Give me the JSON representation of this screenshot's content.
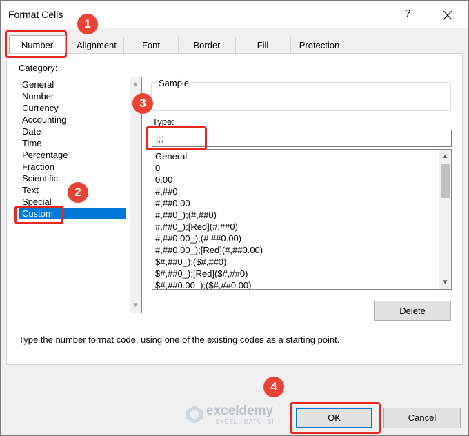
{
  "window": {
    "title": "Format Cells",
    "help": "?",
    "close_icon": "close-icon"
  },
  "tabs": [
    {
      "label": "Number",
      "active": true
    },
    {
      "label": "Alignment",
      "active": false
    },
    {
      "label": "Font",
      "active": false
    },
    {
      "label": "Border",
      "active": false
    },
    {
      "label": "Fill",
      "active": false
    },
    {
      "label": "Protection",
      "active": false
    }
  ],
  "category": {
    "label": "Category:",
    "items": [
      "General",
      "Number",
      "Currency",
      "Accounting",
      "Date",
      "Time",
      "Percentage",
      "Fraction",
      "Scientific",
      "Text",
      "Special",
      "Custom"
    ],
    "selected": "Custom"
  },
  "sample": {
    "label": "Sample",
    "value": ""
  },
  "type": {
    "label": "Type:",
    "value": ";;;"
  },
  "format_codes": [
    "General",
    "0",
    "0.00",
    "#,##0",
    "#,##0.00",
    "#,##0_);(#,##0)",
    "#,##0_);[Red](#,##0)",
    "#,##0.00_);(#,##0.00)",
    "#,##0.00_);[Red](#,##0.00)",
    "$#,##0_);($#,##0)",
    "$#,##0_);[Red]($#,##0)",
    "$#,##0.00_);($#,##0.00)"
  ],
  "buttons": {
    "delete": "Delete",
    "ok": "OK",
    "cancel": "Cancel"
  },
  "hint": "Type the number format code, using one of the existing codes as a starting point.",
  "watermark": {
    "name": "exceldemy",
    "tagline": "EXCEL · DATA · BI"
  },
  "annotations": [
    {
      "step": "1"
    },
    {
      "step": "2"
    },
    {
      "step": "3"
    },
    {
      "step": "4"
    }
  ],
  "colors": {
    "selection": "#0078d7",
    "highlight": "#e8261f",
    "badge": "#e84335"
  }
}
